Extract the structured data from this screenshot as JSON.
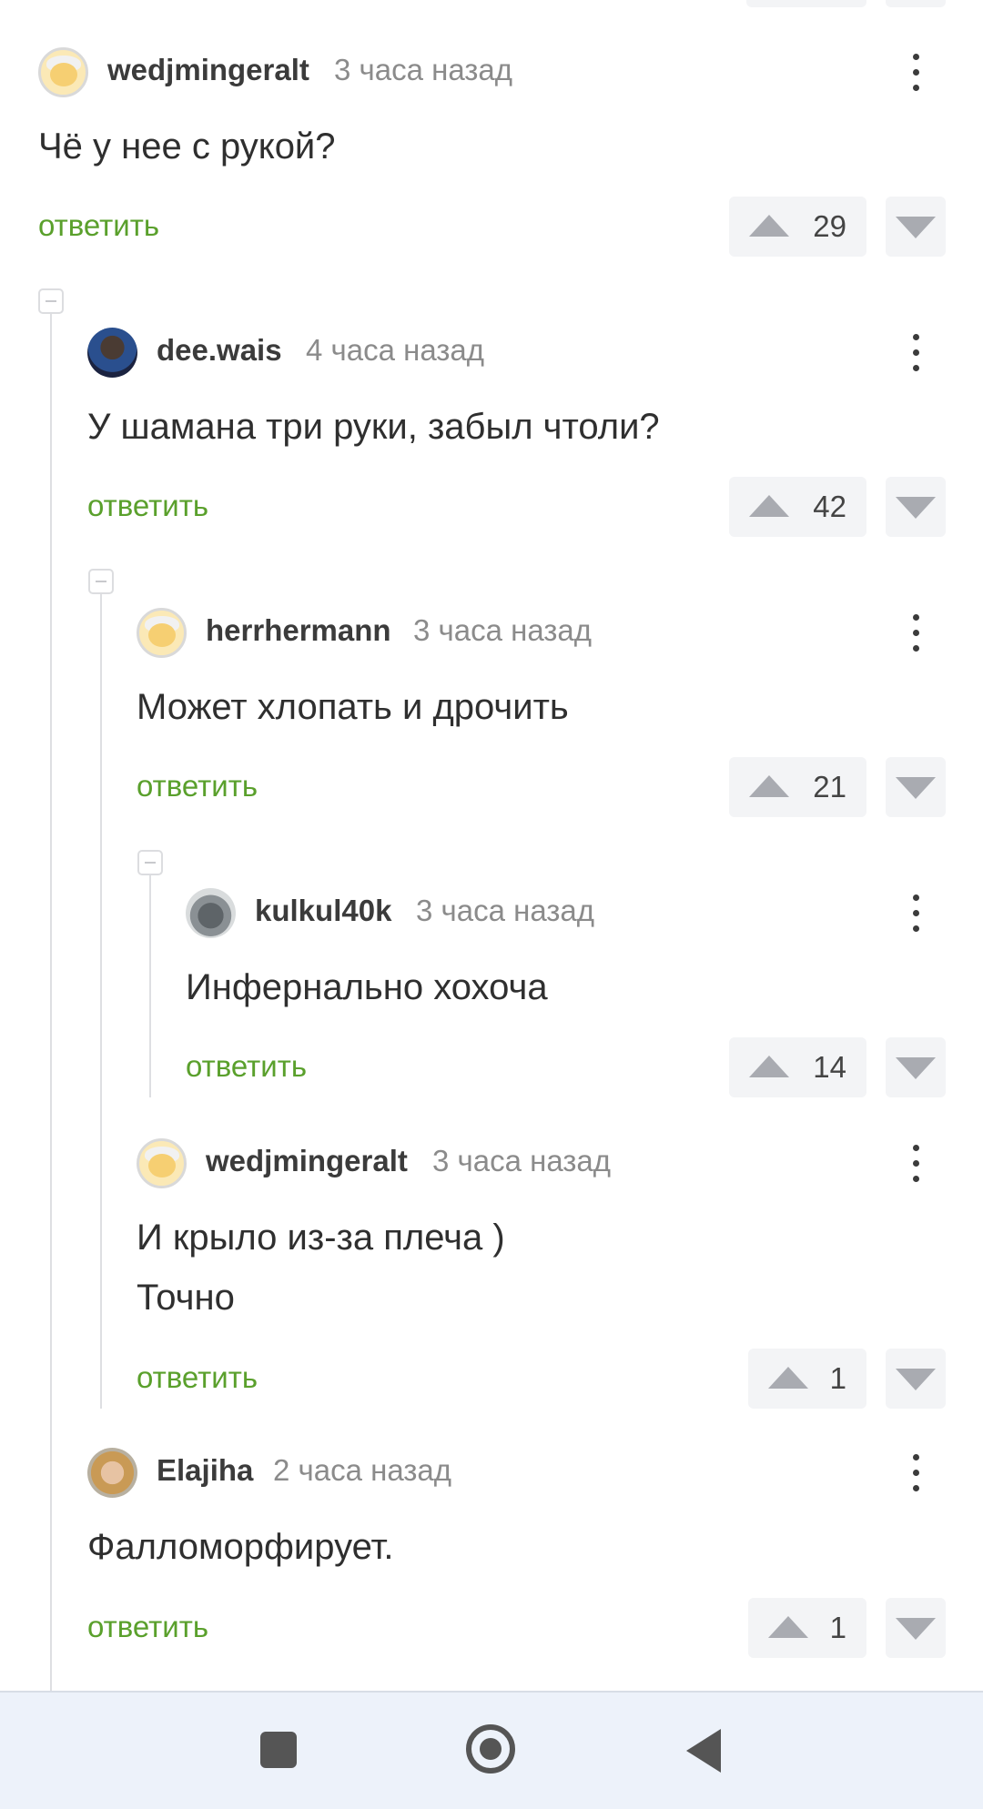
{
  "comments": [
    {
      "user": "wedjmingeralt",
      "time": "3 часа назад",
      "lines": [
        "Чё у нее с рукой?"
      ],
      "reply": "ответить",
      "votes": "29"
    },
    {
      "user": "dee.wais",
      "time": "4 часа назад",
      "lines": [
        "У шамана три руки, забыл чтоли?"
      ],
      "reply": "ответить",
      "votes": "42"
    },
    {
      "user": "herrhermann",
      "time": "3 часа назад",
      "lines": [
        "Может хлопать и дрочить"
      ],
      "reply": "ответить",
      "votes": "21"
    },
    {
      "user": "kulkul40k",
      "time": "3 часа назад",
      "lines": [
        "Инфернально хохоча"
      ],
      "reply": "ответить",
      "votes": "14"
    },
    {
      "user": "wedjmingeralt",
      "time": "3 часа назад",
      "lines": [
        "И крыло из-за плеча )",
        "Точно"
      ],
      "reply": "ответить",
      "votes": "1"
    },
    {
      "user": "Elajiha",
      "time": "2 часа назад",
      "lines": [
        "Фалломорфирует."
      ],
      "reply": "ответить",
      "votes": "1"
    }
  ],
  "icons": {
    "more": "more-vertical-icon",
    "upvote": "arrow-up-icon",
    "downvote": "arrow-down-icon",
    "collapse": "minus-square-icon",
    "nav": [
      "square-recents-icon",
      "circle-home-icon",
      "triangle-back-icon"
    ]
  },
  "colors": {
    "reply_link": "#5aa02c",
    "vote_bg": "#f3f4f6",
    "vote_arrow": "#a9abb1",
    "thread_line": "#dedfe2",
    "navbar_bg": "#edf2fa"
  }
}
